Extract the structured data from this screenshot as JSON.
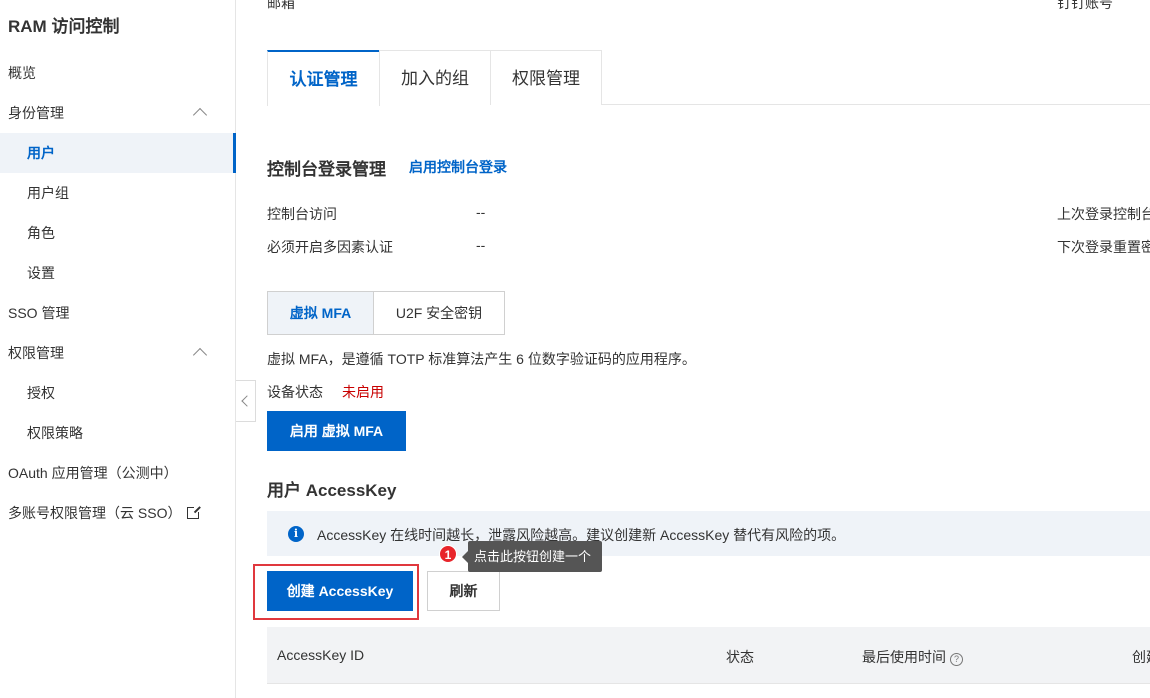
{
  "sidebar": {
    "title": "RAM 访问控制",
    "items": [
      {
        "label": "概览"
      },
      {
        "label": "身份管理"
      },
      {
        "label": "用户"
      },
      {
        "label": "用户组"
      },
      {
        "label": "角色"
      },
      {
        "label": "设置"
      },
      {
        "label": "SSO 管理"
      },
      {
        "label": "权限管理"
      },
      {
        "label": "授权"
      },
      {
        "label": "权限策略"
      },
      {
        "label": "OAuth 应用管理（公测中）"
      },
      {
        "label": "多账号权限管理（云 SSO）"
      }
    ],
    "active_item": "用户",
    "external_icon": "external-link-icon"
  },
  "header_cut": {
    "left": "邮箱",
    "right": "钉钉账号"
  },
  "tabs": [
    {
      "label": "认证管理"
    },
    {
      "label": "加入的组"
    },
    {
      "label": "权限管理"
    }
  ],
  "console_login": {
    "title": "控制台登录管理",
    "enable_link": "启用控制台登录",
    "rows": [
      {
        "label": "控制台访问",
        "value": "--",
        "right_label": "上次登录控制台"
      },
      {
        "label": "必须开启多因素认证",
        "value": "--",
        "right_label": "下次登录重置密"
      }
    ]
  },
  "mfa": {
    "segments": [
      {
        "label": "虚拟 MFA"
      },
      {
        "label": "U2F 安全密钥"
      }
    ],
    "description": "虚拟 MFA，是遵循 TOTP 标准算法产生 6 位数字验证码的应用程序。",
    "status_label": "设备状态",
    "status_value": "未启用",
    "enable_button": "启用 虚拟 MFA"
  },
  "accesskey": {
    "title": "用户 AccessKey",
    "notice": "AccessKey 在线时间越长，泄露风险越高。建议创建新 AccessKey 替代有风险的项。",
    "create_button": "创建 AccessKey",
    "refresh_button": "刷新",
    "tooltip": "点击此按钮创建一个",
    "badge": "1",
    "columns": [
      {
        "label": "AccessKey ID"
      },
      {
        "label": "状态"
      },
      {
        "label": "最后使用时间"
      },
      {
        "label": "创建"
      }
    ]
  },
  "colors": {
    "primary": "#0064c8",
    "danger": "#c80000",
    "highlight_border": "#e0383e"
  }
}
